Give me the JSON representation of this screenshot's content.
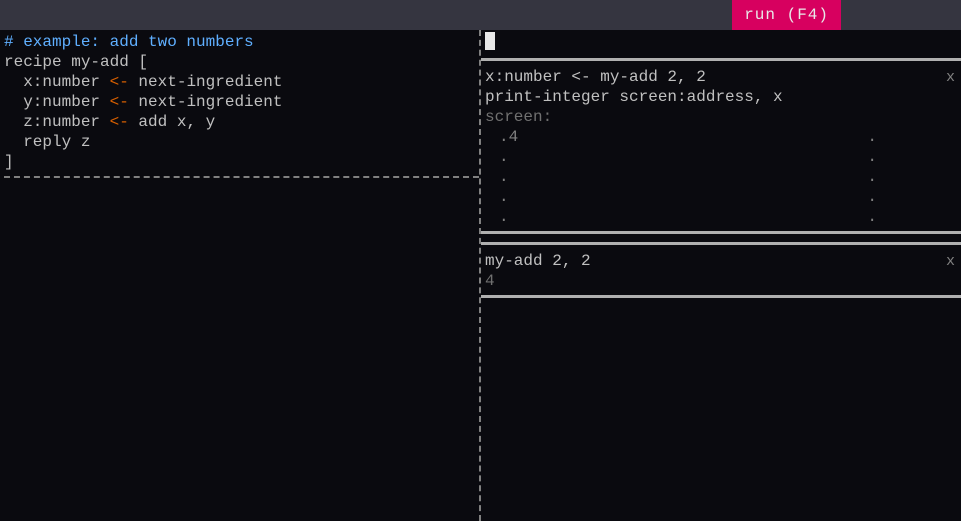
{
  "titleBar": {
    "runLabel": " run (F4) "
  },
  "editor": {
    "lines": [
      {
        "type": "comment",
        "text": "# example: add two numbers"
      },
      {
        "type": "plain",
        "text": "recipe my-add ["
      },
      {
        "type": "assign",
        "left": "  x:number ",
        "arrow": "<-",
        "right": " next-ingredient"
      },
      {
        "type": "assign",
        "left": "  y:number ",
        "arrow": "<-",
        "right": " next-ingredient"
      },
      {
        "type": "assign",
        "left": "  z:number ",
        "arrow": "<-",
        "right": " add x, y"
      },
      {
        "type": "plain",
        "text": "  reply z"
      },
      {
        "type": "plain",
        "text": "]"
      }
    ]
  },
  "sandboxes": [
    {
      "closeLabel": "x",
      "commands": [
        "x:number <- my-add 2, 2",
        "print-integer screen:address, x"
      ],
      "screenLabel": "screen:",
      "screenRows": [
        {
          "left": ".4",
          "right": "."
        },
        {
          "left": ".",
          "right": "."
        },
        {
          "left": ".",
          "right": "."
        },
        {
          "left": ".",
          "right": "."
        },
        {
          "left": ".",
          "right": "."
        }
      ]
    },
    {
      "closeLabel": "x",
      "commands": [
        "my-add 2, 2"
      ],
      "result": "4"
    }
  ]
}
